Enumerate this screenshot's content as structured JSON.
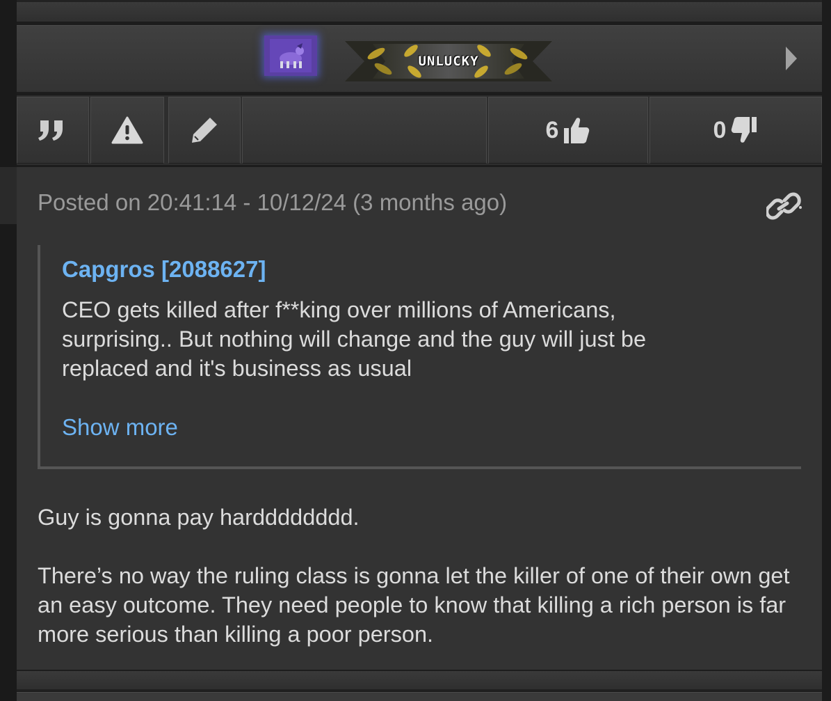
{
  "header": {
    "badge_label": "UNLUCKY"
  },
  "actions": {
    "likes": "6",
    "dislikes": "0"
  },
  "post": {
    "posted_label": "Posted on 20:41:14 - 10/12/24 (3 months ago)",
    "quote": {
      "author": "Capgros [2088627]",
      "lines": [
        "CEO gets killed after f**king over millions of Americans,",
        "surprising.. But nothing will change and the guy will just be",
        "replaced and it's business as usual"
      ],
      "show_more": "Show more"
    },
    "body": [
      "Guy is gonna pay hardddddddd.",
      "There’s no way the ruling class is gonna let the killer of one of their own get an easy outcome. They need people to know that killing a rich person is far more serious than killing a poor person."
    ]
  },
  "colors": {
    "link": "#6db3f2",
    "text": "#dcdcdc",
    "meta": "#9a9a9a"
  }
}
